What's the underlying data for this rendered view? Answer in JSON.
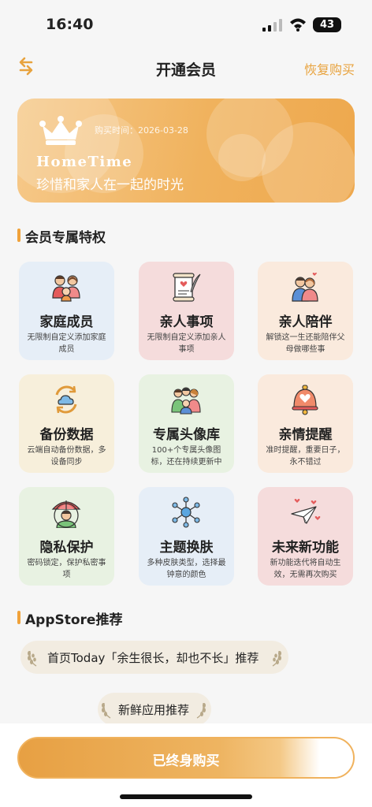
{
  "status_bar": {
    "time": "16:40",
    "battery": "43"
  },
  "header": {
    "title": "开通会员",
    "restore_label": "恢复购买"
  },
  "banner": {
    "purchase_time": "购买时间：2026-03-28",
    "brand": "HomeTime",
    "slogan": "珍惜和家人在一起的时光"
  },
  "privileges": {
    "section_title": "会员专属特权",
    "items": [
      {
        "title": "家庭成员",
        "desc": "无限制自定义添加家庭成员",
        "icon": "family-icon",
        "bg": "#e6eef7"
      },
      {
        "title": "亲人事项",
        "desc": "无限制自定义添加亲人事项",
        "icon": "scroll-quill-icon",
        "bg": "#f5dcdc"
      },
      {
        "title": "亲人陪伴",
        "desc": "解锁这一生还能陪伴父母做哪些事",
        "icon": "hug-icon",
        "bg": "#faeadd"
      },
      {
        "title": "备份数据",
        "desc": "云端自动备份数据，多设备同步",
        "icon": "cloud-sync-icon",
        "bg": "#f7efdb"
      },
      {
        "title": "专属头像库",
        "desc": "100+个专属头像图标，还在持续更新中",
        "icon": "avatar-group-icon",
        "bg": "#e8f2e2"
      },
      {
        "title": "亲情提醒",
        "desc": "准时提醒，重要日子，永不错过",
        "icon": "heart-bell-icon",
        "bg": "#faeadd"
      },
      {
        "title": "隐私保护",
        "desc": "密码锁定，保护私密事项",
        "icon": "umbrella-person-icon",
        "bg": "#e8f2e2"
      },
      {
        "title": "主题换肤",
        "desc": "多种皮肤类型，选择最钟意的颜色",
        "icon": "molecule-icon",
        "bg": "#e6eef7"
      },
      {
        "title": "未来新功能",
        "desc": "新功能迭代将自动生效，无需再次购买",
        "icon": "paper-plane-hearts-icon",
        "bg": "#f5dcdc"
      }
    ]
  },
  "appstore": {
    "section_title": "AppStore推荐",
    "recommendations": [
      "首页Today「余生很长，却也不长」推荐",
      "新鲜应用推荐"
    ]
  },
  "purchase_button": {
    "label": "已终身购买"
  },
  "colors": {
    "accent": "#f0a23a",
    "banner": "#f0b25d"
  }
}
